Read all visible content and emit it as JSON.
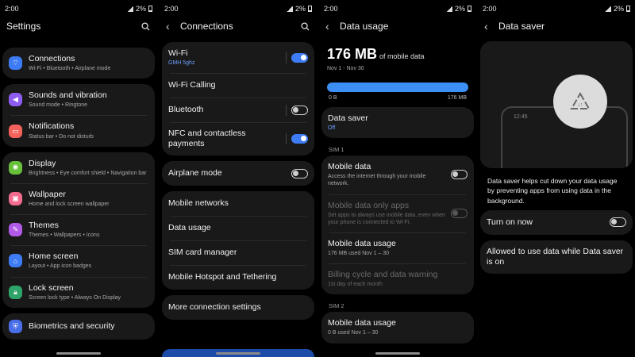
{
  "status": {
    "time": "2:00",
    "battery": "2%"
  },
  "settings": {
    "title": "Settings",
    "items": [
      {
        "label": "Connections",
        "sub": "Wi-Fi  •  Bluetooth  •  Airplane mode",
        "color": "#3d7cf4",
        "icon": "wifi-icon"
      },
      {
        "label": "Sounds and vibration",
        "sub": "Sound mode  •  Ringtone",
        "color": "#8f5cf0",
        "icon": "speaker-icon"
      },
      {
        "label": "Notifications",
        "sub": "Status bar  •  Do not disturb",
        "color": "#f2625a",
        "icon": "bell-icon"
      },
      {
        "label": "Display",
        "sub": "Brightness  •  Eye comfort shield  •  Navigation bar",
        "color": "#67c23a",
        "icon": "sun-icon"
      },
      {
        "label": "Wallpaper",
        "sub": "Home and lock screen wallpaper",
        "color": "#f26a8d",
        "icon": "image-icon"
      },
      {
        "label": "Themes",
        "sub": "Themes  •  Wallpapers  •  Icons",
        "color": "#b25ae8",
        "icon": "themes-icon"
      },
      {
        "label": "Home screen",
        "sub": "Layout  •  App icon badges",
        "color": "#3d7cf4",
        "icon": "home-icon"
      },
      {
        "label": "Lock screen",
        "sub": "Screen lock type  •  Always On Display",
        "color": "#2fa46a",
        "icon": "lock-icon"
      },
      {
        "label": "Biometrics and security",
        "sub": "",
        "color": "#4a6ee8",
        "icon": "shield-icon"
      }
    ]
  },
  "connections": {
    "title": "Connections",
    "wifi": {
      "label": "Wi-Fi",
      "sub": "GMH 5ghz"
    },
    "wifi_calling": "Wi-Fi Calling",
    "bluetooth": "Bluetooth",
    "nfc": "NFC and contactless payments",
    "airplane": "Airplane mode",
    "mobile_networks": "Mobile networks",
    "data_usage": "Data usage",
    "sim_manager": "SIM card manager",
    "hotspot": "Mobile Hotspot and Tethering",
    "more": "More connection settings"
  },
  "data_usage": {
    "title": "Data usage",
    "amount": "176 MB",
    "amount_suffix": "of mobile data",
    "period": "Nov 1 - Nov 30",
    "bar_fraction": 1.0,
    "scale_min": "0 B",
    "scale_max": "176 MB",
    "saver": {
      "label": "Data saver",
      "sub": "Off"
    },
    "sim1_label": "SIM 1",
    "mobile_data": {
      "label": "Mobile data",
      "sub": "Access the internet through your mobile network."
    },
    "data_only_apps": {
      "label": "Mobile data only apps",
      "sub": "Set apps to always use mobile data, even when your phone is connected to Wi-Fi."
    },
    "mobile_usage_1": {
      "label": "Mobile data usage",
      "sub": "176 MB used Nov 1 – 30"
    },
    "billing": {
      "label": "Billing cycle and data warning",
      "sub": "1st day of each month"
    },
    "sim2_label": "SIM 2",
    "mobile_usage_2": {
      "label": "Mobile data usage",
      "sub": "0 B used Nov 1 – 30"
    }
  },
  "data_saver": {
    "title": "Data saver",
    "clock": "12:45",
    "description": "Data saver helps cut down your data usage by preventing apps from using data in the background.",
    "turn_on": "Turn on now",
    "allowed": "Allowed to use data while Data saver is on"
  }
}
